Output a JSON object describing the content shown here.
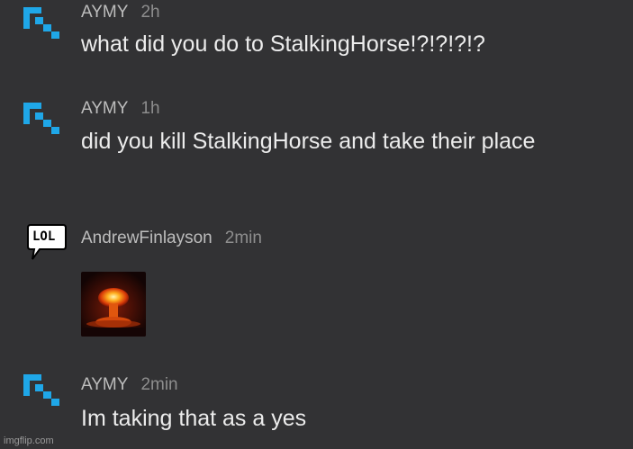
{
  "comments": [
    {
      "user": "AYMY",
      "time": "2h",
      "text": "what did you do to StalkingHorse!?!?!?!?",
      "avatar_icon": "blue-pixel-arrow-icon"
    },
    {
      "user": "AYMY",
      "time": "1h",
      "text": "did you kill StalkingHorse and take their place",
      "avatar_icon": "blue-pixel-arrow-icon"
    },
    {
      "user": "AndrewFinlayson",
      "time": "2min",
      "avatar_icon": "lol-speech-bubble-icon",
      "avatar_text": "LOL",
      "image_icon": "nuclear-explosion-image"
    },
    {
      "user": "AYMY",
      "time": "2min",
      "text": "Im taking that as a yes",
      "avatar_icon": "blue-pixel-arrow-icon"
    }
  ],
  "watermark": "imgflip.com",
  "colors": {
    "background": "#323234",
    "accent": "#1fa7e8"
  }
}
